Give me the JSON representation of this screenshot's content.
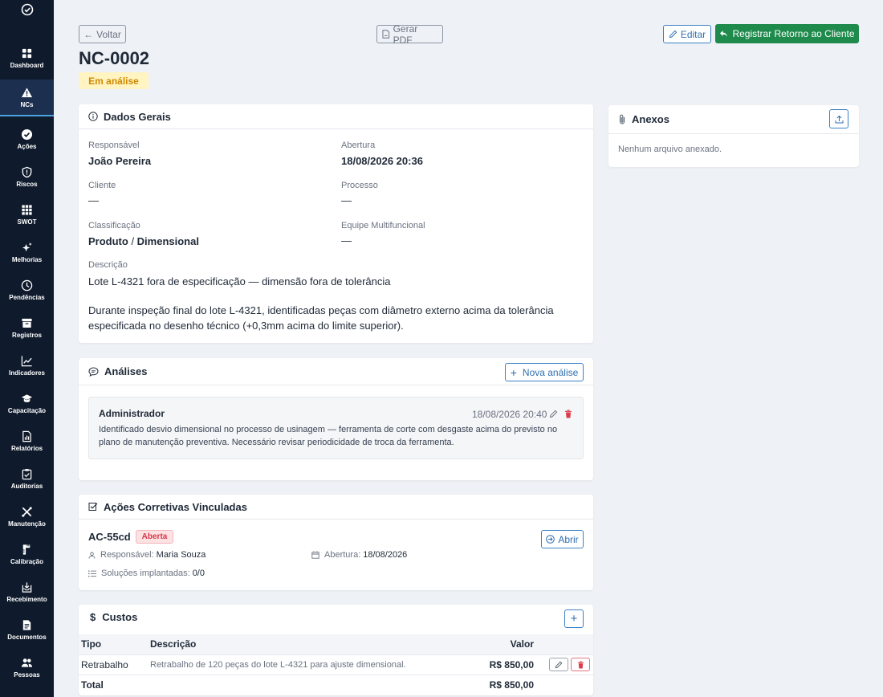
{
  "sidebar": {
    "items": [
      {
        "label": "Dashboard",
        "icon": "grid-icon"
      },
      {
        "label": "NCs",
        "icon": "warning-icon"
      },
      {
        "label": "Ações",
        "icon": "check-circle-icon"
      },
      {
        "label": "Riscos",
        "icon": "shield-icon"
      },
      {
        "label": "SWOT",
        "icon": "grid9-icon"
      },
      {
        "label": "Melhorias",
        "icon": "sparkle-icon"
      },
      {
        "label": "Pendências",
        "icon": "clock-icon"
      },
      {
        "label": "Registros",
        "icon": "archive-icon"
      },
      {
        "label": "Indicadores",
        "icon": "trend-icon"
      },
      {
        "label": "Capacitação",
        "icon": "graduation-icon"
      },
      {
        "label": "Relatórios",
        "icon": "report-icon"
      },
      {
        "label": "Auditorias",
        "icon": "clipboard-icon"
      },
      {
        "label": "Manutenção",
        "icon": "tools-icon"
      },
      {
        "label": "Calibração",
        "icon": "ruler-icon"
      },
      {
        "label": "Recebimento",
        "icon": "inbox-icon"
      },
      {
        "label": "Documentos",
        "icon": "document-icon"
      },
      {
        "label": "Pessoas",
        "icon": "people-icon"
      }
    ]
  },
  "header": {
    "back_label": "Voltar",
    "pdf_label": "Gerar PDF",
    "edit_label": "Editar",
    "return_label": "Registrar Retorno ao Cliente",
    "title": "NC-0002",
    "status": "Em análise"
  },
  "general": {
    "title": "Dados Gerais",
    "responsavel_label": "Responsável",
    "responsavel": "João Pereira",
    "abertura_label": "Abertura",
    "abertura": "18/08/2026 20:36",
    "cliente_label": "Cliente",
    "cliente": "—",
    "processo_label": "Processo",
    "processo": "—",
    "classificacao_label": "Classificação",
    "classificacao_main": "Produto",
    "classificacao_sep": " / ",
    "classificacao_sub": "Dimensional",
    "equipe_label": "Equipe Multifuncional",
    "equipe": "—",
    "descricao_label": "Descrição",
    "descricao_1": "Lote L-4321 fora de especificação — dimensão fora de tolerância",
    "descricao_2": "Durante inspeção final do lote L-4321, identificadas peças com diâmetro externo acima da tolerância especificada no desenho técnico (+0,3mm acima do limite superior)."
  },
  "analyses": {
    "title": "Análises",
    "new_label": "Nova análise",
    "items": [
      {
        "author": "Administrador",
        "date": "18/08/2026 20:40",
        "text": "Identificado desvio dimensional no processo de usinagem — ferramenta de corte com desgaste acima do previsto no plano de manutenção preventiva. Necessário revisar periodicidade de troca da ferramenta."
      }
    ]
  },
  "actions": {
    "title": "Ações Corretivas Vinculadas",
    "items": [
      {
        "code": "AC-55cd",
        "status": "Aberta",
        "open_label": "Abrir",
        "responsavel_label": "Responsável:",
        "responsavel": "Maria Souza",
        "abertura_label": "Abertura:",
        "abertura": "18/08/2026",
        "solucoes_label": "Soluções implantadas:",
        "solucoes": "0/0"
      }
    ]
  },
  "costs": {
    "title": "Custos",
    "headers": {
      "tipo": "Tipo",
      "descricao": "Descrição",
      "valor": "Valor"
    },
    "rows": [
      {
        "tipo": "Retrabalho",
        "descricao": "Retrabalho de 120 peças do lote L-4321 para ajuste dimensional.",
        "valor": "R$ 850,00"
      }
    ],
    "total_label": "Total",
    "total": "R$ 850,00"
  },
  "attachments": {
    "title": "Anexos",
    "empty": "Nenhum arquivo anexado."
  },
  "colors": {
    "sidebar": "#0f1b2d",
    "accent": "#2f6fb0",
    "success": "#1e8a4c",
    "warning": "#d08a00",
    "danger": "#d6384a"
  }
}
